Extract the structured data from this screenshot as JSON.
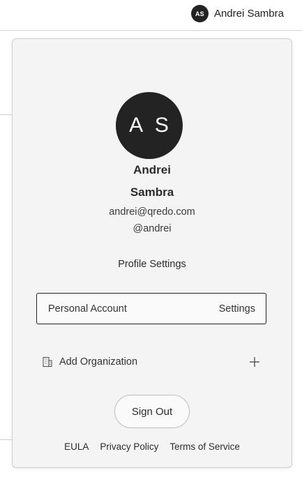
{
  "topbar": {
    "avatar_initials": "AS",
    "user_name": "Andrei Sambra"
  },
  "profile": {
    "avatar_initials": "A S",
    "first_name": "Andrei",
    "last_name": "Sambra",
    "email": "andrei@qredo.com",
    "handle": "@andrei",
    "settings_label": "Profile Settings"
  },
  "account": {
    "label": "Personal Account",
    "settings_label": "Settings"
  },
  "organization": {
    "add_label": "Add Organization",
    "icon": "building-icon",
    "action_icon": "plus-icon"
  },
  "actions": {
    "sign_out_label": "Sign Out"
  },
  "footer": {
    "links": [
      "EULA",
      "Privacy Policy",
      "Terms of Service"
    ]
  },
  "colors": {
    "avatar_bg": "#232323",
    "panel_bg": "#f4f4f4",
    "border": "#cfcfcf"
  }
}
